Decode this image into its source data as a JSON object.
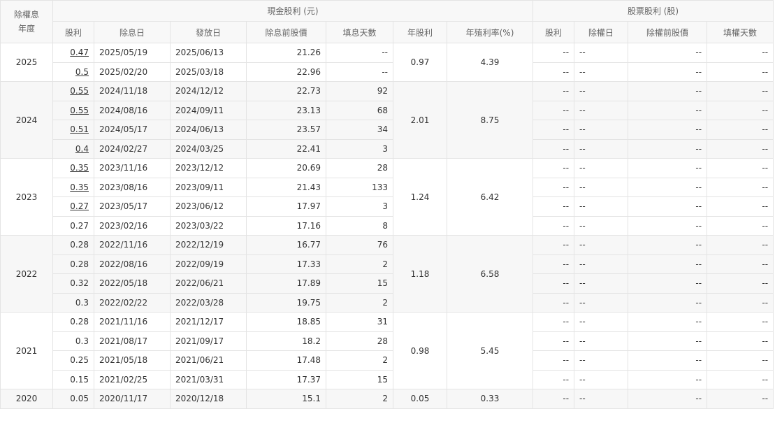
{
  "header": {
    "year_head_line1": "除權息",
    "year_head_line2": "年度",
    "cash_group": "現金股利 (元)",
    "stock_group": "股票股利 (股)",
    "cash_columns": [
      "股利",
      "除息日",
      "發放日",
      "除息前股價",
      "填息天數",
      "年股利",
      "年殖利率(%)"
    ],
    "stock_columns": [
      "股利",
      "除權日",
      "除權前股價",
      "填權天數"
    ]
  },
  "years": [
    {
      "year": "2025",
      "annual_dividend": "0.97",
      "annual_yield": "4.39",
      "rows": [
        {
          "dividend": "0.47",
          "link": true,
          "ex_date": "2025/05/19",
          "pay_date": "2025/06/13",
          "pre_price": "21.26",
          "fill_days": "--",
          "s_div": "--",
          "s_date": "--",
          "s_price": "--",
          "s_days": "--"
        },
        {
          "dividend": "0.5",
          "link": true,
          "ex_date": "2025/02/20",
          "pay_date": "2025/03/18",
          "pre_price": "22.96",
          "fill_days": "--",
          "s_div": "--",
          "s_date": "--",
          "s_price": "--",
          "s_days": "--"
        }
      ]
    },
    {
      "year": "2024",
      "annual_dividend": "2.01",
      "annual_yield": "8.75",
      "rows": [
        {
          "dividend": "0.55",
          "link": true,
          "ex_date": "2024/11/18",
          "pay_date": "2024/12/12",
          "pre_price": "22.73",
          "fill_days": "92",
          "s_div": "--",
          "s_date": "--",
          "s_price": "--",
          "s_days": "--"
        },
        {
          "dividend": "0.55",
          "link": true,
          "ex_date": "2024/08/16",
          "pay_date": "2024/09/11",
          "pre_price": "23.13",
          "fill_days": "68",
          "s_div": "--",
          "s_date": "--",
          "s_price": "--",
          "s_days": "--"
        },
        {
          "dividend": "0.51",
          "link": true,
          "ex_date": "2024/05/17",
          "pay_date": "2024/06/13",
          "pre_price": "23.57",
          "fill_days": "34",
          "s_div": "--",
          "s_date": "--",
          "s_price": "--",
          "s_days": "--"
        },
        {
          "dividend": "0.4",
          "link": true,
          "ex_date": "2024/02/27",
          "pay_date": "2024/03/25",
          "pre_price": "22.41",
          "fill_days": "3",
          "s_div": "--",
          "s_date": "--",
          "s_price": "--",
          "s_days": "--"
        }
      ]
    },
    {
      "year": "2023",
      "annual_dividend": "1.24",
      "annual_yield": "6.42",
      "rows": [
        {
          "dividend": "0.35",
          "link": true,
          "ex_date": "2023/11/16",
          "pay_date": "2023/12/12",
          "pre_price": "20.69",
          "fill_days": "28",
          "s_div": "--",
          "s_date": "--",
          "s_price": "--",
          "s_days": "--"
        },
        {
          "dividend": "0.35",
          "link": true,
          "ex_date": "2023/08/16",
          "pay_date": "2023/09/11",
          "pre_price": "21.43",
          "fill_days": "133",
          "s_div": "--",
          "s_date": "--",
          "s_price": "--",
          "s_days": "--"
        },
        {
          "dividend": "0.27",
          "link": true,
          "ex_date": "2023/05/17",
          "pay_date": "2023/06/12",
          "pre_price": "17.97",
          "fill_days": "3",
          "s_div": "--",
          "s_date": "--",
          "s_price": "--",
          "s_days": "--"
        },
        {
          "dividend": "0.27",
          "link": false,
          "ex_date": "2023/02/16",
          "pay_date": "2023/03/22",
          "pre_price": "17.16",
          "fill_days": "8",
          "s_div": "--",
          "s_date": "--",
          "s_price": "--",
          "s_days": "--"
        }
      ]
    },
    {
      "year": "2022",
      "annual_dividend": "1.18",
      "annual_yield": "6.58",
      "rows": [
        {
          "dividend": "0.28",
          "link": false,
          "ex_date": "2022/11/16",
          "pay_date": "2022/12/19",
          "pre_price": "16.77",
          "fill_days": "76",
          "s_div": "--",
          "s_date": "--",
          "s_price": "--",
          "s_days": "--"
        },
        {
          "dividend": "0.28",
          "link": false,
          "ex_date": "2022/08/16",
          "pay_date": "2022/09/19",
          "pre_price": "17.33",
          "fill_days": "2",
          "s_div": "--",
          "s_date": "--",
          "s_price": "--",
          "s_days": "--"
        },
        {
          "dividend": "0.32",
          "link": false,
          "ex_date": "2022/05/18",
          "pay_date": "2022/06/21",
          "pre_price": "17.89",
          "fill_days": "15",
          "s_div": "--",
          "s_date": "--",
          "s_price": "--",
          "s_days": "--"
        },
        {
          "dividend": "0.3",
          "link": false,
          "ex_date": "2022/02/22",
          "pay_date": "2022/03/28",
          "pre_price": "19.75",
          "fill_days": "2",
          "s_div": "--",
          "s_date": "--",
          "s_price": "--",
          "s_days": "--"
        }
      ]
    },
    {
      "year": "2021",
      "annual_dividend": "0.98",
      "annual_yield": "5.45",
      "rows": [
        {
          "dividend": "0.28",
          "link": false,
          "ex_date": "2021/11/16",
          "pay_date": "2021/12/17",
          "pre_price": "18.85",
          "fill_days": "31",
          "s_div": "--",
          "s_date": "--",
          "s_price": "--",
          "s_days": "--"
        },
        {
          "dividend": "0.3",
          "link": false,
          "ex_date": "2021/08/17",
          "pay_date": "2021/09/17",
          "pre_price": "18.2",
          "fill_days": "28",
          "s_div": "--",
          "s_date": "--",
          "s_price": "--",
          "s_days": "--"
        },
        {
          "dividend": "0.25",
          "link": false,
          "ex_date": "2021/05/18",
          "pay_date": "2021/06/21",
          "pre_price": "17.48",
          "fill_days": "2",
          "s_div": "--",
          "s_date": "--",
          "s_price": "--",
          "s_days": "--"
        },
        {
          "dividend": "0.15",
          "link": false,
          "ex_date": "2021/02/25",
          "pay_date": "2021/03/31",
          "pre_price": "17.37",
          "fill_days": "15",
          "s_div": "--",
          "s_date": "--",
          "s_price": "--",
          "s_days": "--"
        }
      ]
    },
    {
      "year": "2020",
      "annual_dividend": "0.05",
      "annual_yield": "0.33",
      "rows": [
        {
          "dividend": "0.05",
          "link": false,
          "ex_date": "2020/11/17",
          "pay_date": "2020/12/18",
          "pre_price": "15.1",
          "fill_days": "2",
          "s_div": "--",
          "s_date": "--",
          "s_price": "--",
          "s_days": "--"
        }
      ]
    }
  ]
}
